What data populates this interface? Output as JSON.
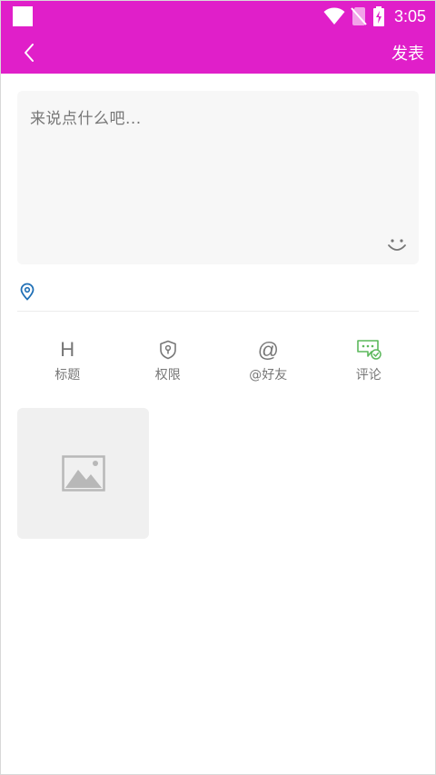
{
  "status_bar": {
    "time": "3:05",
    "icons": [
      "notification-square-icon",
      "wifi-icon",
      "no-sim-icon",
      "battery-charging-icon"
    ]
  },
  "app_bar": {
    "back_icon": "chevron-left-icon",
    "publish_label": "发表"
  },
  "editor": {
    "placeholder": "来说点什么吧...",
    "value": "",
    "emoji_icon": "smiley-icon"
  },
  "location": {
    "icon": "location-pin-icon"
  },
  "toolbar": {
    "items": [
      {
        "label": "标题",
        "glyph": "H",
        "icon": "heading-icon"
      },
      {
        "label": "权限",
        "icon": "shield-lock-icon"
      },
      {
        "label": "@好友",
        "glyph": "@",
        "icon": "mention-icon"
      },
      {
        "label": "评论",
        "icon": "comment-enabled-icon"
      }
    ]
  },
  "image_picker": {
    "icon": "image-placeholder-icon"
  },
  "colors": {
    "accent": "#e01fc9",
    "comment_icon": "#5cb85c",
    "location_icon": "#1f6fb5",
    "muted": "#777777"
  }
}
